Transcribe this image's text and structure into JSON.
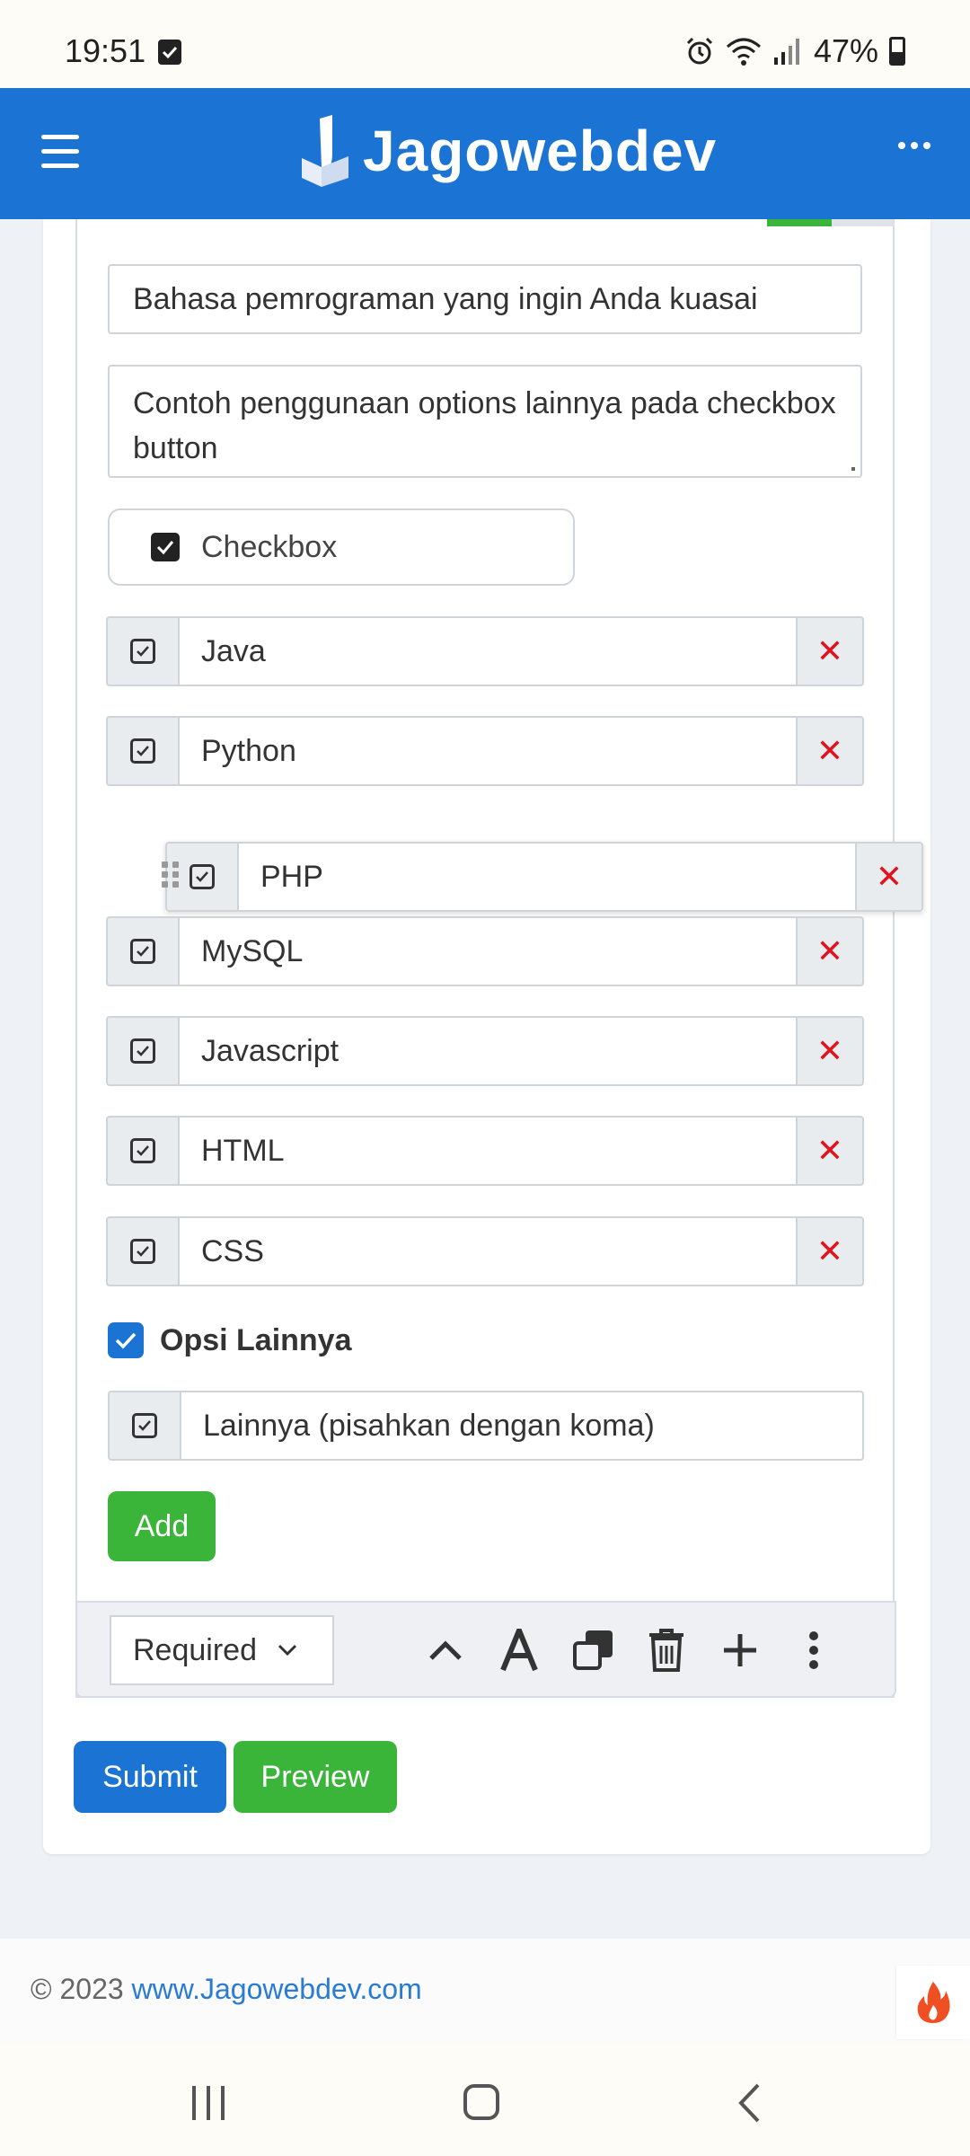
{
  "status_bar": {
    "time": "19:51",
    "battery": "47%"
  },
  "app_bar": {
    "brand": "Jagowebdev"
  },
  "form": {
    "question_title": "Bahasa pemrograman yang ingin Anda kuasai",
    "question_description": "Contoh penggunaan options lainnya pada checkbox button",
    "question_type": "Checkbox",
    "options": [
      "Java",
      "Python",
      "PHP",
      "MySQL",
      "Javascript",
      "HTML",
      "CSS"
    ],
    "other_option": {
      "label": "Opsi Lainnya",
      "checked": true,
      "placeholder": "Lainnya (pisahkan dengan koma)"
    },
    "add_label": "Add",
    "required_select": "Required",
    "remove_glyph": "✕"
  },
  "actions": {
    "submit": "Submit",
    "preview": "Preview"
  },
  "footer": {
    "copyright": "© 2023",
    "link": "www.Jagowebdev.com"
  },
  "colors": {
    "primary": "#1b74d3",
    "success": "#3bb539",
    "danger": "#e0141e"
  }
}
